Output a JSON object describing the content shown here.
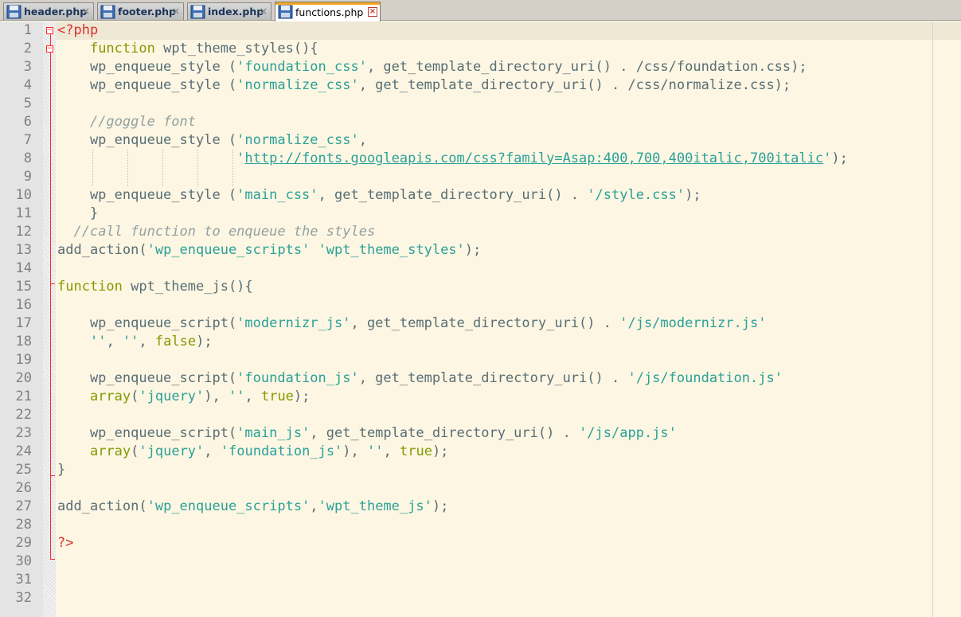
{
  "tabs": [
    {
      "label": "header.php",
      "active": false
    },
    {
      "label": "footer.php",
      "active": false
    },
    {
      "label": "index.php",
      "active": false
    },
    {
      "label": "functions.php",
      "active": true
    }
  ],
  "tab_close_glyph": "×",
  "icons": {
    "file": "save-file-icon",
    "close": "close-icon"
  },
  "colors": {
    "background": "#fdf6e3",
    "keyword": "#859900",
    "string": "#2aa198",
    "comment": "#93a1a1",
    "php_tag": "#dc322f",
    "default": "#586e75",
    "fold_marker": "#ff2a2a"
  },
  "editor": {
    "current_line": 1,
    "lines": [
      {
        "n": "1",
        "tokens": [
          {
            "t": "<?php",
            "c": "php"
          }
        ]
      },
      {
        "n": "2",
        "tokens": [
          {
            "t": "    ",
            "c": "default"
          },
          {
            "t": "function",
            "c": "kw"
          },
          {
            "t": " wpt_theme_styles(){",
            "c": "default"
          }
        ]
      },
      {
        "n": "3",
        "tokens": [
          {
            "t": "    wp_enqueue_style (",
            "c": "default"
          },
          {
            "t": "'foundation_css'",
            "c": "str"
          },
          {
            "t": ", get_template_directory_uri() . /css/foundation.css);",
            "c": "default"
          }
        ]
      },
      {
        "n": "4",
        "tokens": [
          {
            "t": "    wp_enqueue_style (",
            "c": "default"
          },
          {
            "t": "'normalize_css'",
            "c": "str"
          },
          {
            "t": ", get_template_directory_uri() . /css/normalize.css);",
            "c": "default"
          }
        ]
      },
      {
        "n": "5",
        "tokens": []
      },
      {
        "n": "6",
        "tokens": [
          {
            "t": "    ",
            "c": "default"
          },
          {
            "t": "//goggle font",
            "c": "comment"
          }
        ]
      },
      {
        "n": "7",
        "tokens": [
          {
            "t": "    wp_enqueue_style (",
            "c": "default"
          },
          {
            "t": "'normalize_css'",
            "c": "str"
          },
          {
            "t": ",",
            "c": "default"
          }
        ]
      },
      {
        "n": "8",
        "tokens": [
          {
            "t": "                      ",
            "c": "default"
          },
          {
            "t": "'",
            "c": "str"
          },
          {
            "t": "http://fonts.googleapis.com/css?family=Asap:400,700,400italic,700italic",
            "c": "url"
          },
          {
            "t": "'",
            "c": "str"
          },
          {
            "t": ");",
            "c": "default"
          }
        ]
      },
      {
        "n": "9",
        "tokens": []
      },
      {
        "n": "10",
        "tokens": [
          {
            "t": "    wp_enqueue_style (",
            "c": "default"
          },
          {
            "t": "'main_css'",
            "c": "str"
          },
          {
            "t": ", get_template_directory_uri() . ",
            "c": "default"
          },
          {
            "t": "'/style.css'",
            "c": "str"
          },
          {
            "t": ");",
            "c": "default"
          }
        ]
      },
      {
        "n": "11",
        "tokens": [
          {
            "t": "    }",
            "c": "default"
          }
        ]
      },
      {
        "n": "12",
        "tokens": [
          {
            "t": "  ",
            "c": "default"
          },
          {
            "t": "//call function to enqueue the styles",
            "c": "comment"
          }
        ]
      },
      {
        "n": "13",
        "tokens": [
          {
            "t": "add_action(",
            "c": "default"
          },
          {
            "t": "'wp_enqueue_scripts'",
            "c": "str"
          },
          {
            "t": " ",
            "c": "default"
          },
          {
            "t": "'wpt_theme_styles'",
            "c": "str"
          },
          {
            "t": ");",
            "c": "default"
          }
        ]
      },
      {
        "n": "14",
        "tokens": []
      },
      {
        "n": "15",
        "tokens": [
          {
            "t": "function",
            "c": "kw"
          },
          {
            "t": " wpt_theme_js(){",
            "c": "default"
          }
        ]
      },
      {
        "n": "16",
        "tokens": []
      },
      {
        "n": "17",
        "tokens": [
          {
            "t": "    wp_enqueue_script(",
            "c": "default"
          },
          {
            "t": "'modernizr_js'",
            "c": "str"
          },
          {
            "t": ", get_template_directory_uri() . ",
            "c": "default"
          },
          {
            "t": "'/js/modernizr.js'",
            "c": "str"
          }
        ]
      },
      {
        "n": "18",
        "tokens": [
          {
            "t": "    ",
            "c": "default"
          },
          {
            "t": "''",
            "c": "str"
          },
          {
            "t": ", ",
            "c": "default"
          },
          {
            "t": "''",
            "c": "str"
          },
          {
            "t": ", ",
            "c": "default"
          },
          {
            "t": "false",
            "c": "kw"
          },
          {
            "t": ");",
            "c": "default"
          }
        ]
      },
      {
        "n": "19",
        "tokens": []
      },
      {
        "n": "20",
        "tokens": [
          {
            "t": "    wp_enqueue_script(",
            "c": "default"
          },
          {
            "t": "'foundation_js'",
            "c": "str"
          },
          {
            "t": ", get_template_directory_uri() . ",
            "c": "default"
          },
          {
            "t": "'/js/foundation.js'",
            "c": "str"
          }
        ]
      },
      {
        "n": "21",
        "tokens": [
          {
            "t": "    ",
            "c": "default"
          },
          {
            "t": "array",
            "c": "kw"
          },
          {
            "t": "(",
            "c": "default"
          },
          {
            "t": "'jquery'",
            "c": "str"
          },
          {
            "t": "), ",
            "c": "default"
          },
          {
            "t": "''",
            "c": "str"
          },
          {
            "t": ", ",
            "c": "default"
          },
          {
            "t": "true",
            "c": "kw"
          },
          {
            "t": ");",
            "c": "default"
          }
        ]
      },
      {
        "n": "22",
        "tokens": []
      },
      {
        "n": "23",
        "tokens": [
          {
            "t": "    wp_enqueue_script(",
            "c": "default"
          },
          {
            "t": "'main_js'",
            "c": "str"
          },
          {
            "t": ", get_template_directory_uri() . ",
            "c": "default"
          },
          {
            "t": "'/js/app.js'",
            "c": "str"
          }
        ]
      },
      {
        "n": "24",
        "tokens": [
          {
            "t": "    ",
            "c": "default"
          },
          {
            "t": "array",
            "c": "kw"
          },
          {
            "t": "(",
            "c": "default"
          },
          {
            "t": "'jquery'",
            "c": "str"
          },
          {
            "t": ", ",
            "c": "default"
          },
          {
            "t": "'foundation_js'",
            "c": "str"
          },
          {
            "t": "), ",
            "c": "default"
          },
          {
            "t": "''",
            "c": "str"
          },
          {
            "t": ", ",
            "c": "default"
          },
          {
            "t": "true",
            "c": "kw"
          },
          {
            "t": ");",
            "c": "default"
          }
        ]
      },
      {
        "n": "25",
        "tokens": [
          {
            "t": "}",
            "c": "default"
          }
        ]
      },
      {
        "n": "26",
        "tokens": []
      },
      {
        "n": "27",
        "tokens": [
          {
            "t": "add_action(",
            "c": "default"
          },
          {
            "t": "'wp_enqueue_scripts'",
            "c": "str"
          },
          {
            "t": ",",
            "c": "default"
          },
          {
            "t": "'wpt_theme_js'",
            "c": "str"
          },
          {
            "t": ");",
            "c": "default"
          }
        ]
      },
      {
        "n": "28",
        "tokens": []
      },
      {
        "n": "29",
        "tokens": [
          {
            "t": "?>",
            "c": "php"
          }
        ]
      },
      {
        "n": "30",
        "tokens": []
      },
      {
        "n": "31",
        "tokens": []
      },
      {
        "n": "32",
        "tokens": []
      }
    ]
  }
}
